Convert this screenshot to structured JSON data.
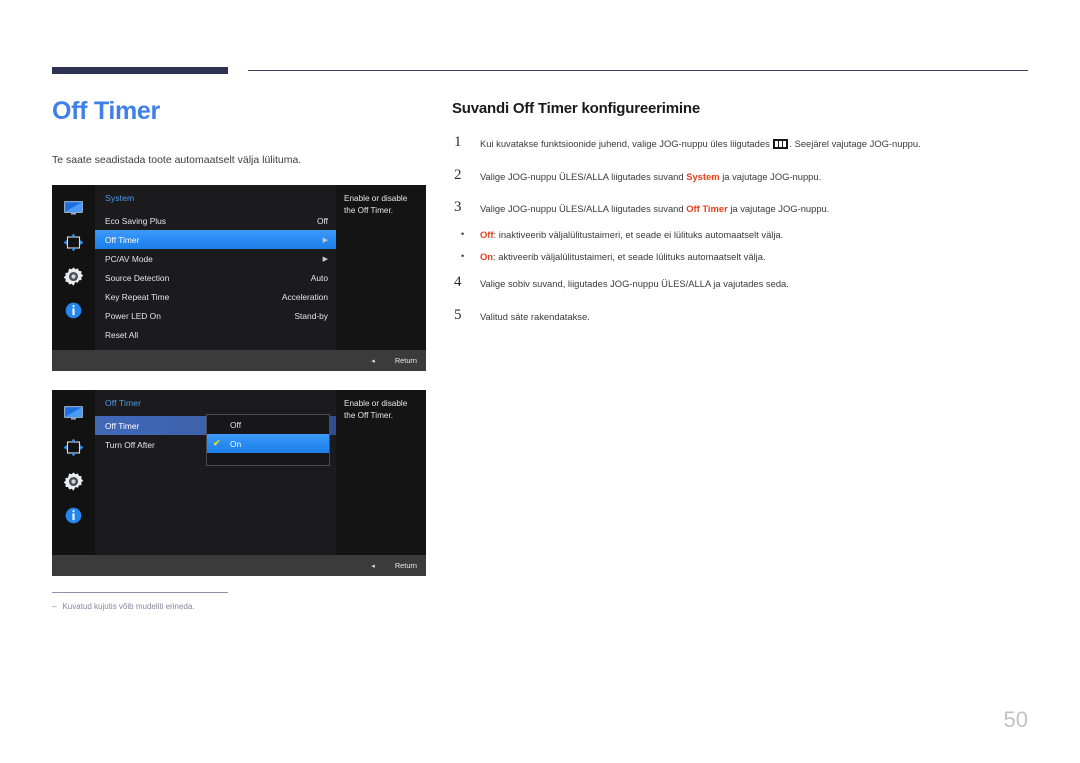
{
  "document": {
    "page_number": "50"
  },
  "left": {
    "title": "Off Timer",
    "intro": "Te saate seadistada toote automaatselt välja lülituma.",
    "footnote_dash": "‒",
    "footnote": "Kuvatud kujutis võib mudeliti erineda."
  },
  "osd_common": {
    "help_text": "Enable or disable the Off Timer.",
    "return_label": "Return",
    "back_glyph": "◂",
    "icons": [
      "monitor-icon",
      "picture-size-icon",
      "gear-icon",
      "info-icon"
    ]
  },
  "osd_system": {
    "menu_title": "System",
    "rows": [
      {
        "label": "Eco Saving Plus",
        "value": "Off",
        "arrow": "",
        "highlight": "none"
      },
      {
        "label": "Off Timer",
        "value": "",
        "arrow": "▶",
        "highlight": "bright"
      },
      {
        "label": "PC/AV Mode",
        "value": "",
        "arrow": "▶",
        "highlight": "none"
      },
      {
        "label": "Source Detection",
        "value": "Auto",
        "arrow": "",
        "highlight": "none"
      },
      {
        "label": "Key Repeat Time",
        "value": "Acceleration",
        "arrow": "",
        "highlight": "none"
      },
      {
        "label": "Power LED On",
        "value": "Stand-by",
        "arrow": "",
        "highlight": "none"
      },
      {
        "label": "Reset All",
        "value": "",
        "arrow": "",
        "highlight": "none"
      }
    ]
  },
  "osd_offtimer": {
    "menu_title": "Off Timer",
    "rows": [
      {
        "label": "Off Timer",
        "value": "",
        "arrow": "",
        "highlight": "dim"
      },
      {
        "label": "Turn Off After",
        "value": "",
        "arrow": "",
        "highlight": "none"
      }
    ],
    "popup": {
      "options": [
        {
          "label": "Off",
          "checked": false,
          "highlight": false
        },
        {
          "label": "On",
          "checked": true,
          "highlight": true
        }
      ],
      "check_glyph": "✔"
    }
  },
  "right": {
    "section_title": "Suvandi Off Timer konfigureerimine",
    "steps": [
      {
        "num": "1",
        "text_before": "Kui kuvatakse funktsioonide juhend, valige JOG-nuppu üles liigutades",
        "glyph": "menu-icon",
        "text_after": ". Seejärel vajutage JOG-nuppu."
      },
      {
        "num": "2",
        "text_before": "Valige JOG-nuppu ÜLES/ALLA liigutades suvand",
        "hot": "System",
        "text_after": "ja vajutage JOG-nuppu."
      },
      {
        "num": "3",
        "text_before": "Valige JOG-nuppu ÜLES/ALLA liigutades suvand",
        "hot": "Off Timer",
        "text_after": "ja vajutage JOG-nuppu."
      }
    ],
    "bullets": [
      {
        "dot": "•",
        "hot": "Off",
        "text": ": inaktiveerib väljalülitustaimeri, et seade ei lülituks automaatselt välja."
      },
      {
        "dot": "•",
        "hot": "On",
        "text": ": aktiveerib väljalülitustaimeri, et seade lülituks automaatselt välja."
      }
    ],
    "steps_tail": [
      {
        "num": "4",
        "text": "Valige sobiv suvand, liigutades JOG-nuppu ÜLES/ALLA ja vajutades seda."
      },
      {
        "num": "5",
        "text": "Valitud säte rakendatakse."
      }
    ]
  }
}
